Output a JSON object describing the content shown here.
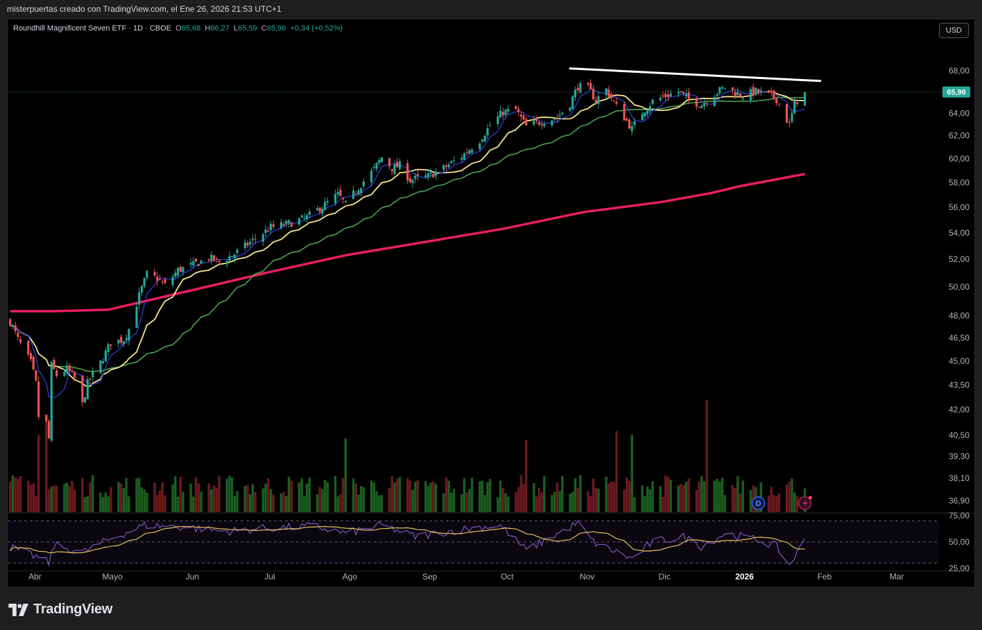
{
  "header": {
    "attribution": "misterpuertas creado con TradingView.com, el Ene 26, 2026 21:53 UTC+1"
  },
  "legend": {
    "name": "Roundhill Magnificent Seven ETF · 1D · CBOE",
    "o_label": "O",
    "o_value": "65,68",
    "h_label": "H",
    "h_value": "66,27",
    "l_label": "L",
    "l_value": "65,59",
    "c_label": "C",
    "c_value": "65,96",
    "change": "+0,34 (+0,52%)"
  },
  "currency_button": "USD",
  "brand": "TradingView",
  "colors": {
    "up": "#26a69a",
    "down": "#ef5350",
    "vol_up": "#1b5e20",
    "vol_down": "#6b1a1f",
    "ma_fast": "#2d3fd6",
    "ma_mid": "#f7e58f",
    "ma_slow": "#4caf50",
    "ma_200": "#e91e63",
    "trendline": "#ffffff",
    "rsi": "#7e57c2",
    "rsi_ma": "#e6c15a",
    "last_price_tag": "#26a69a"
  },
  "markers": {
    "dividend_icon": "D",
    "flash_icon": "lightning-icon"
  },
  "chart_data": {
    "type": "candlestick",
    "price_axis": {
      "labels": [
        "68,00",
        "64,00",
        "62,00",
        "60,00",
        "58,00",
        "56,00",
        "54,00",
        "52,00",
        "50,00",
        "48,00",
        "46,50",
        "45,00",
        "43,50",
        "42,00",
        "40,50",
        "39,30",
        "38,10",
        "36,90"
      ],
      "scale": "log",
      "range": [
        36.3,
        70.3
      ]
    },
    "last_price": {
      "value": 65.96,
      "label": "65,96"
    },
    "time_axis": {
      "labels": [
        {
          "date": "2025-04-01",
          "label": "Abr"
        },
        {
          "date": "2025-05-01",
          "label": "Mayo"
        },
        {
          "date": "2025-06-01",
          "label": "Jun"
        },
        {
          "date": "2025-07-01",
          "label": "Jul"
        },
        {
          "date": "2025-08-01",
          "label": "Ago"
        },
        {
          "date": "2025-09-01",
          "label": "Sep"
        },
        {
          "date": "2025-10-01",
          "label": "Oct"
        },
        {
          "date": "2025-11-01",
          "label": "Nov"
        },
        {
          "date": "2025-12-01",
          "label": "Dic"
        },
        {
          "date": "2026-01-01",
          "label": "2026"
        },
        {
          "date": "2026-02-01",
          "label": "Feb"
        },
        {
          "date": "2026-03-01",
          "label": "Mar"
        }
      ],
      "range": [
        "2025-03-23",
        "2026-03-19"
      ]
    },
    "close_path": [
      [
        "2025-03-24",
        47.6
      ],
      [
        "2025-03-27",
        46.4
      ],
      [
        "2025-04-01",
        44.9
      ],
      [
        "2025-04-03",
        43.6
      ],
      [
        "2025-04-04",
        41.6
      ],
      [
        "2025-04-07",
        41.2
      ],
      [
        "2025-04-08",
        40.3
      ],
      [
        "2025-04-09",
        44.7
      ],
      [
        "2025-04-11",
        44.1
      ],
      [
        "2025-04-15",
        44.5
      ],
      [
        "2025-04-18",
        43.9
      ],
      [
        "2025-04-21",
        42.3
      ],
      [
        "2025-04-23",
        43.6
      ],
      [
        "2025-04-28",
        44.9
      ],
      [
        "2025-05-02",
        46.2
      ],
      [
        "2025-05-07",
        46.4
      ],
      [
        "2025-05-09",
        47.1
      ],
      [
        "2025-05-13",
        49.4
      ],
      [
        "2025-05-16",
        50.9
      ],
      [
        "2025-05-20",
        50.6
      ],
      [
        "2025-05-23",
        50.1
      ],
      [
        "2025-05-28",
        51.2
      ],
      [
        "2025-06-03",
        51.6
      ],
      [
        "2025-06-09",
        52.1
      ],
      [
        "2025-06-13",
        51.8
      ],
      [
        "2025-06-19",
        52.4
      ],
      [
        "2025-06-26",
        53.4
      ],
      [
        "2025-07-03",
        54.4
      ],
      [
        "2025-07-10",
        54.7
      ],
      [
        "2025-07-17",
        55.2
      ],
      [
        "2025-07-24",
        56.2
      ],
      [
        "2025-07-29",
        57.0
      ],
      [
        "2025-08-01",
        56.2
      ],
      [
        "2025-08-06",
        57.6
      ],
      [
        "2025-08-12",
        59.1
      ],
      [
        "2025-08-15",
        60.1
      ],
      [
        "2025-08-19",
        59.2
      ],
      [
        "2025-08-22",
        59.4
      ],
      [
        "2025-08-26",
        58.2
      ],
      [
        "2025-09-02",
        58.5
      ],
      [
        "2025-09-08",
        59.2
      ],
      [
        "2025-09-15",
        60.2
      ],
      [
        "2025-09-22",
        61.6
      ],
      [
        "2025-09-26",
        62.9
      ],
      [
        "2025-10-01",
        64.1
      ],
      [
        "2025-10-06",
        64.3
      ],
      [
        "2025-10-10",
        62.8
      ],
      [
        "2025-10-15",
        63.2
      ],
      [
        "2025-10-22",
        63.6
      ],
      [
        "2025-10-27",
        64.9
      ],
      [
        "2025-10-30",
        66.5
      ],
      [
        "2025-11-03",
        66.3
      ],
      [
        "2025-11-06",
        65.2
      ],
      [
        "2025-11-10",
        66.2
      ],
      [
        "2025-11-14",
        64.6
      ],
      [
        "2025-11-18",
        63.3
      ],
      [
        "2025-11-20",
        62.6
      ],
      [
        "2025-11-24",
        64.1
      ],
      [
        "2025-11-28",
        65.1
      ],
      [
        "2025-12-03",
        65.6
      ],
      [
        "2025-12-08",
        66.0
      ],
      [
        "2025-12-12",
        65.2
      ],
      [
        "2025-12-17",
        64.8
      ],
      [
        "2025-12-22",
        65.8
      ],
      [
        "2025-12-26",
        66.4
      ],
      [
        "2026-01-02",
        65.6
      ],
      [
        "2026-01-07",
        66.0
      ],
      [
        "2026-01-12",
        65.7
      ],
      [
        "2026-01-15",
        65.3
      ],
      [
        "2026-01-20",
        62.9
      ],
      [
        "2026-01-22",
        64.9
      ],
      [
        "2026-01-26",
        65.96
      ]
    ],
    "volume_spikes": [
      {
        "date": "2025-04-04",
        "relative_height": 0.62
      },
      {
        "date": "2025-04-07",
        "relative_height": 0.78
      },
      {
        "date": "2025-08-01",
        "relative_height": 0.59
      },
      {
        "date": "2025-10-10",
        "relative_height": 0.58
      },
      {
        "date": "2025-11-14",
        "relative_height": 0.65
      },
      {
        "date": "2025-11-20",
        "relative_height": 0.62
      },
      {
        "date": "2025-12-19",
        "relative_height": 0.9
      }
    ],
    "series": [
      {
        "kind": "MA fast",
        "color": "#2d3fd6"
      },
      {
        "kind": "MA medium",
        "color": "#f7e58f"
      },
      {
        "kind": "MA slow",
        "color": "#4caf50"
      },
      {
        "kind": "MA 200",
        "color": "#e91e63",
        "points": [
          [
            "2025-03-24",
            48.3
          ],
          [
            "2025-04-10",
            48.3
          ],
          [
            "2025-05-01",
            48.4
          ],
          [
            "2025-06-01",
            49.7
          ],
          [
            "2025-07-01",
            51.0
          ],
          [
            "2025-08-01",
            52.3
          ],
          [
            "2025-09-01",
            53.3
          ],
          [
            "2025-10-01",
            54.3
          ],
          [
            "2025-11-01",
            55.6
          ],
          [
            "2025-12-01",
            56.4
          ],
          [
            "2025-12-20",
            57.1
          ],
          [
            "2026-01-01",
            57.7
          ],
          [
            "2026-01-26",
            58.7
          ]
        ]
      }
    ],
    "trendline": {
      "from": [
        "2025-10-27",
        68.2
      ],
      "to": [
        "2026-02-01",
        67.0
      ]
    },
    "rsi": {
      "axis_labels": [
        "75,00",
        "50,00",
        "25,00"
      ],
      "levels": [
        70,
        50,
        30
      ],
      "range": [
        23,
        77
      ],
      "points": [
        [
          "2025-03-24",
          45
        ],
        [
          "2025-04-04",
          35
        ],
        [
          "2025-04-08",
          30
        ],
        [
          "2025-04-10",
          47
        ],
        [
          "2025-04-21",
          40
        ],
        [
          "2025-05-01",
          52
        ],
        [
          "2025-05-15",
          66
        ],
        [
          "2025-06-01",
          64
        ],
        [
          "2025-06-15",
          60
        ],
        [
          "2025-07-01",
          63
        ],
        [
          "2025-07-20",
          65
        ],
        [
          "2025-08-01",
          58
        ],
        [
          "2025-08-15",
          66
        ],
        [
          "2025-08-28",
          55
        ],
        [
          "2025-09-15",
          62
        ],
        [
          "2025-09-30",
          66
        ],
        [
          "2025-10-10",
          42
        ],
        [
          "2025-10-20",
          55
        ],
        [
          "2025-10-30",
          68
        ],
        [
          "2025-11-05",
          50
        ],
        [
          "2025-11-20",
          34
        ],
        [
          "2025-11-28",
          50
        ],
        [
          "2025-12-10",
          55
        ],
        [
          "2025-12-17",
          46
        ],
        [
          "2025-12-26",
          58
        ],
        [
          "2026-01-08",
          52
        ],
        [
          "2026-01-15",
          46
        ],
        [
          "2026-01-20",
          28
        ],
        [
          "2026-01-26",
          51
        ]
      ]
    }
  }
}
